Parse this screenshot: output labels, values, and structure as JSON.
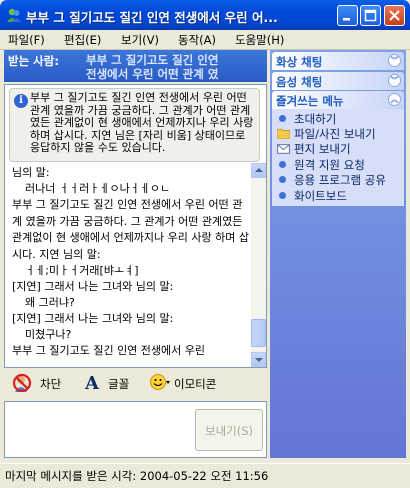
{
  "window": {
    "title": "부부 그 질기고도 질긴 인연 전생에서 우린 어...",
    "controls": {
      "minimize": "_",
      "maximize": "□",
      "close": "✕"
    }
  },
  "menu": [
    "파일(F)",
    "편집(E)",
    "보기(V)",
    "동작(A)",
    "도움말(H)"
  ],
  "recipient": {
    "label": "받는 사람:",
    "name_line1": "부부 그 질기고도 질긴 인연",
    "name_line2": "전생에서 우린 어떤 관계 였"
  },
  "notice": {
    "text": "부부 그 질기고도 질긴 인연 전생에서 우린 어떤 관계 였을까 가끔 궁금하다. 그 관계가 어떤 관계였든 관계없이 현 생애에서 언제까지나 우리 사랑 하며 삽시다. 지연 님은 [자리 비움] 상태이므로 응답하지 않을 수도 있습니다."
  },
  "messages": [
    {
      "kind": "head",
      "text": "                  님의 말:"
    },
    {
      "kind": "indent",
      "text": "러나너 ㅓㅓ러ㅏㅔㅇ나ㅓㅔㅇㄴ"
    },
    {
      "kind": "body",
      "text": "부부 그 질기고도 질긴 인연 전생에서 우린 어떤 관계 였을까 가끔 궁금하다. 그 관계가 어떤 관계였든 관계없이 현 생애에서 언제까지나 우리 사랑 하며 삽시다. 지연 님의 말:"
    },
    {
      "kind": "indent",
      "text": "ㅓㅔ;미ㅏㅓ거래[뱌ㅗㅕ]"
    },
    {
      "kind": "head",
      "text": "[지연] 그래서 나는 그녀와 님의 말:"
    },
    {
      "kind": "indent",
      "text": "왜 그러냐?"
    },
    {
      "kind": "head",
      "text": "[지연] 그래서 나는 그녀와 님의 말:"
    },
    {
      "kind": "indent",
      "text": "미쳤구나?"
    },
    {
      "kind": "body",
      "text": "부부 그 질기고도 질긴 인연 전생에서 우린"
    }
  ],
  "tools": {
    "block": "차단",
    "font": "글꼴",
    "emoticon": "이모티콘"
  },
  "send_button": "보내기(S)",
  "status": "마지막 메시지를 받은 시각: 2004-05-22 오전 11:56",
  "sidebar": {
    "sections": [
      {
        "label": "화상 채팅",
        "expanded": false
      },
      {
        "label": "음성 채팅",
        "expanded": false
      },
      {
        "label": "즐겨쓰는 메뉴",
        "expanded": true
      }
    ],
    "favorites": [
      {
        "label": "초대하기",
        "icon": "invite-icon"
      },
      {
        "label": "파일/사진 보내기",
        "icon": "folder-icon"
      },
      {
        "label": "편지 보내기",
        "icon": "mail-icon"
      },
      {
        "label": "원격 지원 요청",
        "icon": "remote-icon"
      },
      {
        "label": "응용 프로그램 공유",
        "icon": "share-icon"
      },
      {
        "label": "화이트보드",
        "icon": "whiteboard-icon"
      }
    ]
  },
  "colors": {
    "titlebar": "#0048d8",
    "sidebar": "#6f8fdf",
    "link": "#0a246a"
  }
}
